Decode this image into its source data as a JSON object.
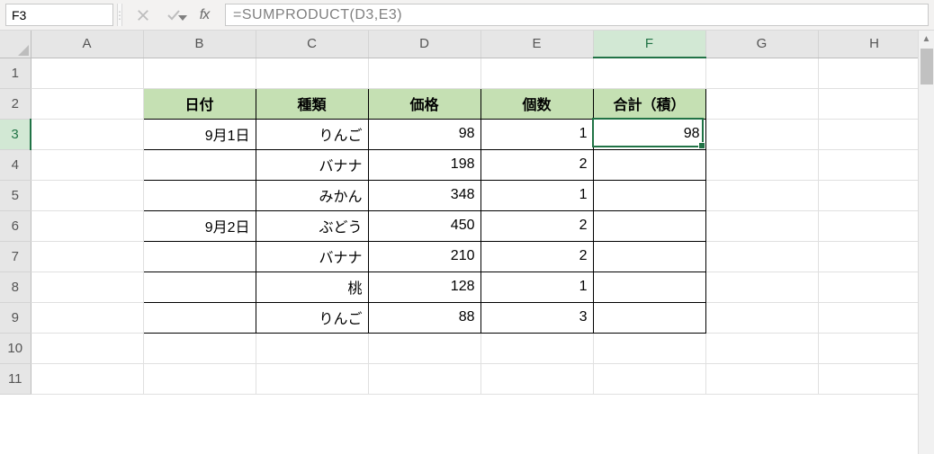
{
  "name_box": "F3",
  "formula_bar": "=SUMPRODUCT(D3,E3)",
  "columns": [
    "A",
    "B",
    "C",
    "D",
    "E",
    "F",
    "G",
    "H"
  ],
  "rows": [
    "1",
    "2",
    "3",
    "4",
    "5",
    "6",
    "7",
    "8",
    "9",
    "10",
    "11"
  ],
  "active_cell": {
    "col": "F",
    "row": "3"
  },
  "headers": {
    "B2": "日付",
    "C2": "種類",
    "D2": "価格",
    "E2": "個数",
    "F2": "合計（積）"
  },
  "data": [
    {
      "B": "9月1日",
      "C": "りんご",
      "D": "98",
      "E": "1",
      "F": "98"
    },
    {
      "B": "",
      "C": "バナナ",
      "D": "198",
      "E": "2",
      "F": ""
    },
    {
      "B": "",
      "C": "みかん",
      "D": "348",
      "E": "1",
      "F": ""
    },
    {
      "B": "9月2日",
      "C": "ぶどう",
      "D": "450",
      "E": "2",
      "F": ""
    },
    {
      "B": "",
      "C": "バナナ",
      "D": "210",
      "E": "2",
      "F": ""
    },
    {
      "B": "",
      "C": "桃",
      "D": "128",
      "E": "1",
      "F": ""
    },
    {
      "B": "",
      "C": "りんご",
      "D": "88",
      "E": "3",
      "F": ""
    }
  ],
  "theme": {
    "header_fill": "#c5e0b3",
    "selection": "#217346"
  }
}
